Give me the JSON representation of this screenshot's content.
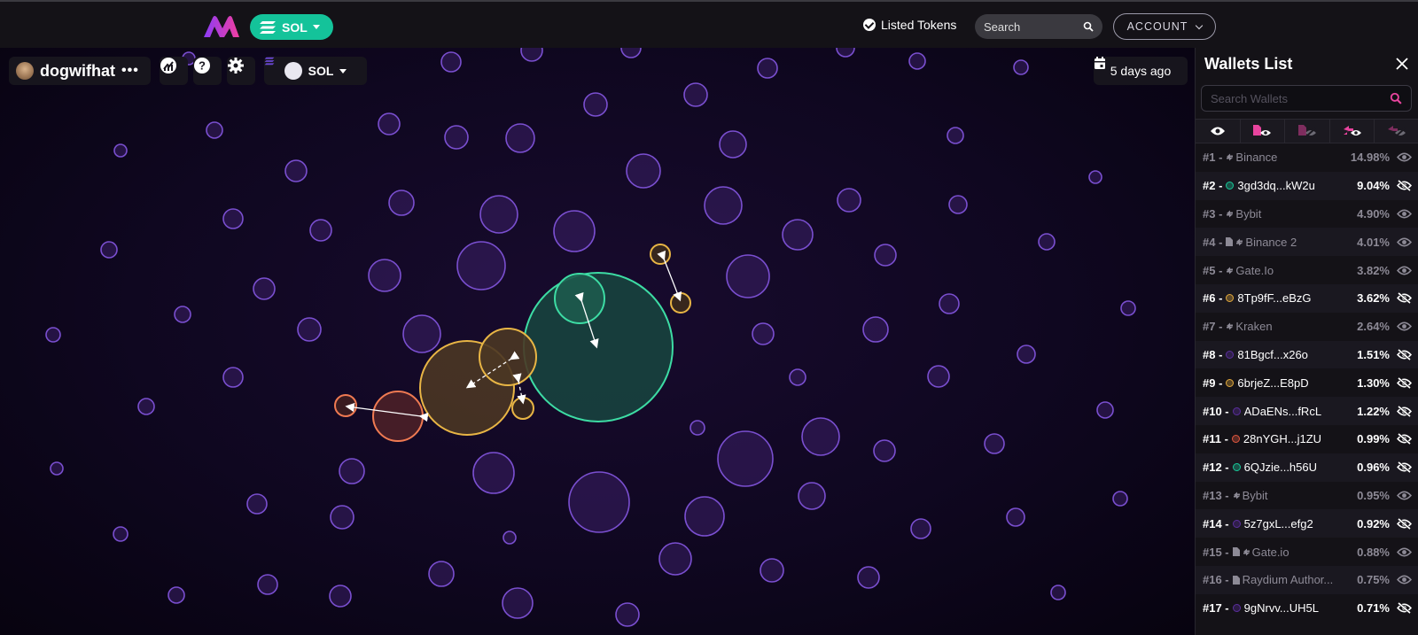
{
  "header": {
    "chain_label": "SOL",
    "listed_tokens": "Listed Tokens",
    "search_placeholder": "Search",
    "account_label": "ACCOUNT",
    "colors": {
      "chain_pill": "#14c39a",
      "bar": "#141217"
    }
  },
  "toolbar": {
    "token_name": "dogwifhat",
    "more_label": "•••",
    "chain_select": "SOL",
    "date_label": "5 days ago",
    "icons": [
      "chart-icon",
      "help-icon",
      "settings-icon"
    ]
  },
  "panel": {
    "title": "Wallets List",
    "search_placeholder": "Search Wallets",
    "filters": [
      "eye-icon",
      "contract-eye-icon",
      "contract-hidden-icon",
      "exchange-eye-icon",
      "exchange-hidden-icon"
    ],
    "wallets": [
      {
        "rank": "#1 -",
        "name": "Binance",
        "pct": "14.98%",
        "kind": "exchange",
        "dim": true,
        "visible": true
      },
      {
        "rank": "#2 -",
        "name": "3gd3dq...kW2u",
        "pct": "9.04%",
        "kind": "wallet",
        "color": "#19c798",
        "dim": false,
        "visible": false
      },
      {
        "rank": "#3 -",
        "name": "Bybit",
        "pct": "4.90%",
        "kind": "exchange",
        "dim": true,
        "visible": true
      },
      {
        "rank": "#4 -",
        "name": "Binance 2",
        "pct": "4.01%",
        "kind": "contract-exchange",
        "dim": true,
        "visible": true
      },
      {
        "rank": "#5 -",
        "name": "Gate.Io",
        "pct": "3.82%",
        "kind": "exchange",
        "dim": true,
        "visible": true
      },
      {
        "rank": "#6 -",
        "name": "8Tp9fF...eBzG",
        "pct": "3.62%",
        "kind": "wallet",
        "color": "#e2a93d",
        "dim": false,
        "visible": false
      },
      {
        "rank": "#7 -",
        "name": "Kraken",
        "pct": "2.64%",
        "kind": "exchange",
        "dim": true,
        "visible": true
      },
      {
        "rank": "#8 -",
        "name": "81Bgcf...x26o",
        "pct": "1.51%",
        "kind": "wallet",
        "color": "#5a2e9c",
        "dim": false,
        "visible": false
      },
      {
        "rank": "#9 -",
        "name": "6brjeZ...E8pD",
        "pct": "1.30%",
        "kind": "wallet",
        "color": "#e2a93d",
        "dim": false,
        "visible": false
      },
      {
        "rank": "#10 -",
        "name": "ADaENs...fRcL",
        "pct": "1.22%",
        "kind": "wallet",
        "color": "#5a2e9c",
        "dim": false,
        "visible": false
      },
      {
        "rank": "#11 -",
        "name": "28nYGH...j1ZU",
        "pct": "0.99%",
        "kind": "wallet",
        "color": "#e0573f",
        "dim": false,
        "visible": false
      },
      {
        "rank": "#12 -",
        "name": "6QJzie...h56U",
        "pct": "0.96%",
        "kind": "wallet",
        "color": "#19c798",
        "dim": false,
        "visible": false
      },
      {
        "rank": "#13 -",
        "name": "Bybit",
        "pct": "0.95%",
        "kind": "exchange",
        "dim": true,
        "visible": true
      },
      {
        "rank": "#14 -",
        "name": "5z7gxL...efg2",
        "pct": "0.92%",
        "kind": "wallet",
        "color": "#5a2e9c",
        "dim": false,
        "visible": false
      },
      {
        "rank": "#15 -",
        "name": "Gate.io",
        "pct": "0.88%",
        "kind": "contract-exchange",
        "dim": true,
        "visible": true
      },
      {
        "rank": "#16 -",
        "name": "Raydium Author...",
        "pct": "0.75%",
        "kind": "contract",
        "dim": true,
        "visible": true
      },
      {
        "rank": "#17 -",
        "name": "9gNrvv...UH5L",
        "pct": "0.71%",
        "kind": "wallet",
        "color": "#5a2e9c",
        "dim": false,
        "visible": false
      }
    ]
  },
  "bubble_colors": {
    "purple": "#7a4fd0",
    "green": "#3ddca4",
    "yellow": "#e8b545",
    "orange": "#ef7a52"
  }
}
